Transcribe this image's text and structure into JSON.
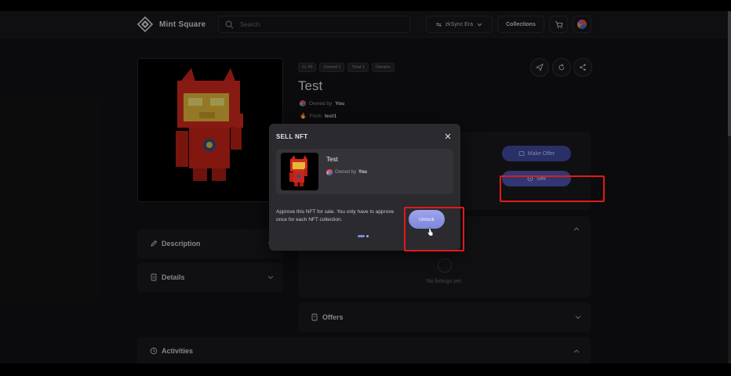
{
  "header": {
    "brand": "Mint Square",
    "search_placeholder": "Search",
    "network_label": "zkSync Era",
    "collections_label": "Collections"
  },
  "nft": {
    "tags": [
      "Cr #0",
      "Owned 1",
      "Total 1",
      "Owners"
    ],
    "title": "Test",
    "owned_prefix": "Owned by",
    "owner": "You",
    "from_prefix": "From",
    "collection": "test1"
  },
  "actions": {
    "make_offer": "Make Offer",
    "sell": "Sell"
  },
  "sections": {
    "description": "Description",
    "details": "Details",
    "offers": "Offers",
    "activities": "Activities",
    "no_listings": "No listings yet."
  },
  "modal": {
    "title": "SELL NFT",
    "nft_name": "Test",
    "owned_prefix": "Owned by",
    "owner": "You",
    "approve_text": "Approve this NFT for sale. You only have to approve once for each NFT collection.",
    "unlock_label": "Unlock"
  },
  "colors": {
    "accent": "#4a55b0",
    "highlight": "#e21a1a",
    "background": "#121214"
  }
}
